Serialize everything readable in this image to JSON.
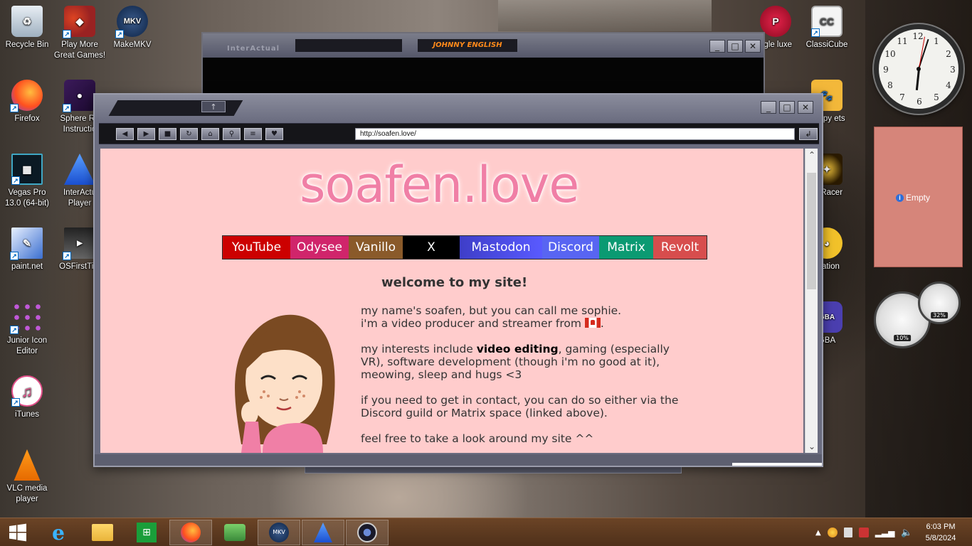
{
  "desktop": {
    "icons": [
      {
        "label": "Recycle Bin",
        "icon": "recycle-bin-icon"
      },
      {
        "label": "Play More Great Games!",
        "icon": "games-icon"
      },
      {
        "label": "MakeMKV",
        "icon": "makemkv-icon"
      },
      {
        "label": "Firefox",
        "icon": "firefox-icon"
      },
      {
        "label": "Sphere Ra Instructio",
        "icon": "sphere-icon"
      },
      {
        "label": "Vegas Pro 13.0 (64-bit)",
        "icon": "vegas-icon"
      },
      {
        "label": "InterActu Player",
        "icon": "interactual-icon"
      },
      {
        "label": "paint.net",
        "icon": "paintnet-icon"
      },
      {
        "label": "OSFirstTim",
        "icon": "osfirsttime-icon"
      },
      {
        "label": "Junior Icon Editor",
        "icon": "junior-icon-editor-icon"
      },
      {
        "label": "iTunes",
        "icon": "itunes-icon"
      },
      {
        "label": "VLC media player",
        "icon": "vlc-icon"
      },
      {
        "label": "ggle luxe",
        "icon": "puggle-icon"
      },
      {
        "label": "ClassiCube",
        "icon": "classicube-icon"
      },
      {
        "label": "Puppy ets",
        "icon": "puppy-icon"
      },
      {
        "label": "re Racer",
        "icon": "racer-icon"
      },
      {
        "label": "Station",
        "icon": "station-icon"
      },
      {
        "label": "GBA",
        "icon": "gba-icon"
      }
    ]
  },
  "gadgets": {
    "note_label": "Empty",
    "info_glyph": "i",
    "clock": {
      "numbers": [
        "12",
        "1",
        "2",
        "3",
        "4",
        "5",
        "6",
        "7",
        "8",
        "9",
        "10",
        "11"
      ]
    },
    "cpu_value": "10%",
    "mem_value": "32%"
  },
  "back_window": {
    "title_left": "InterActual",
    "title_logo": "JOHNNY ENGLISH"
  },
  "browser": {
    "url": "http://soafen.love/",
    "toolbar_glyphs": [
      "◀",
      "▶",
      "■",
      "↻",
      "⌂",
      "⚲",
      "≡",
      "♥"
    ],
    "up_glyph": "↑",
    "go_glyph": "↲",
    "window_controls": {
      "minimize": "_",
      "maximize": "□",
      "close": "✕"
    }
  },
  "site": {
    "logo": "soafen.love",
    "links": [
      {
        "label": "YouTube",
        "color": "#cc0000"
      },
      {
        "label": "Odysee",
        "color": "#d0256b"
      },
      {
        "label": "Vanillo",
        "color": "#8a5a2a"
      },
      {
        "label": "X",
        "color": "#000000"
      },
      {
        "label": "Mastodon",
        "color": "#595aff"
      },
      {
        "label": "Discord",
        "color": "#5865f2"
      },
      {
        "label": "Matrix",
        "color": "#0dbd8b"
      },
      {
        "label": "Revolt",
        "color": "#d74d4d"
      }
    ],
    "welcome": "welcome to my site!",
    "intro_line1": "my name's soafen, but you can call me sophie.",
    "intro_line2": "i'm a video producer and streamer from",
    "intro_end": ".",
    "interests_pre": "my interests include ",
    "interests_bold": "video editing",
    "interests_post": ", gaming (especially VR), software development (though i'm no good at it), meowing, sleep and hugs <3",
    "contact": "if you need to get in contact, you can do so either via the Discord guild or Matrix space (linked above).",
    "feel_free": "feel free to take a look around my site ^^"
  },
  "taskbar": {
    "items": [
      "start-icon",
      "internet-explorer-icon",
      "file-explorer-icon",
      "store-icon",
      "firefox-icon",
      "network-people-icon",
      "makemkv-icon",
      "interactual-icon",
      "obs-icon"
    ],
    "time": "6:03 PM",
    "date": "5/8/2024"
  }
}
